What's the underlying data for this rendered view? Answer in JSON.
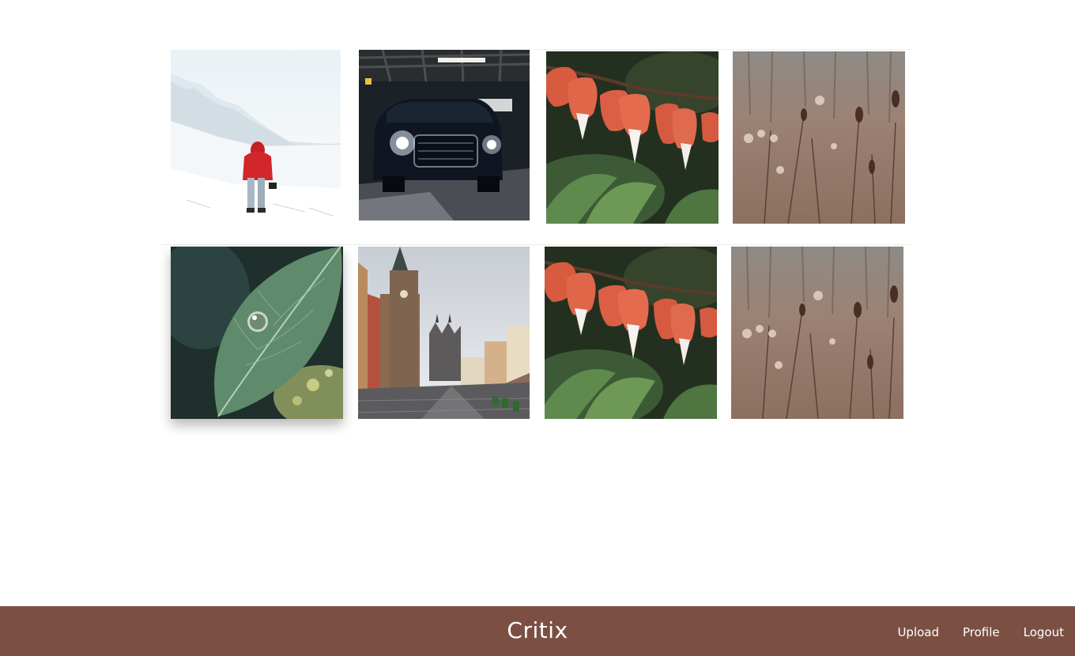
{
  "footer": {
    "brand": "Critix",
    "nav": {
      "upload": "Upload",
      "profile": "Profile",
      "logout": "Logout"
    },
    "background_color": "#7b5043"
  },
  "gallery": {
    "photos": [
      {
        "subject": "hiker-in-snow"
      },
      {
        "subject": "car-headlights-parking-garage"
      },
      {
        "subject": "bleeding-heart-flowers"
      },
      {
        "subject": "dry-teasel-field"
      },
      {
        "subject": "water-drop-on-leaf"
      },
      {
        "subject": "prague-old-town-square"
      },
      {
        "subject": "bleeding-heart-flowers"
      },
      {
        "subject": "dry-teasel-field"
      }
    ]
  }
}
